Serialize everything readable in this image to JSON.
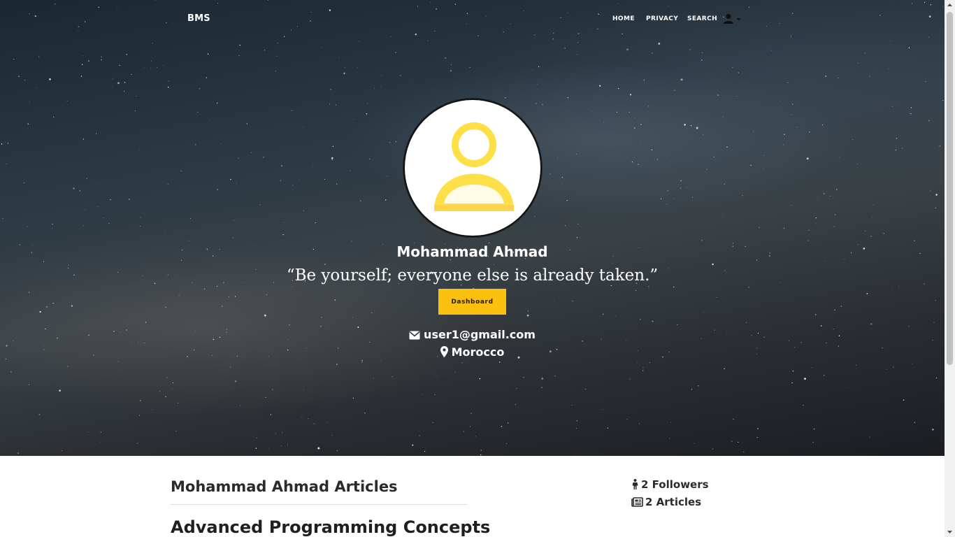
{
  "nav": {
    "brand": "BMS",
    "links": [
      "HOME",
      "PRIVACY",
      "SEARCH"
    ],
    "user_icon": "user-icon",
    "dropdown_icon": "caret-down-icon"
  },
  "profile": {
    "name": "Mohammad Ahmad",
    "quote": "“Be yourself; everyone else is already taken.”",
    "dashboard_label": "Dashboard",
    "email": "user1@gmail.com",
    "location": "Morocco",
    "email_icon": "envelope-icon",
    "location_icon": "map-marker-icon",
    "avatar_icon": "user-avatar-icon"
  },
  "articles": {
    "heading": "Mohammad Ahmad Articles",
    "items": [
      "Advanced Programming Concepts"
    ]
  },
  "stats": {
    "followers": "2 Followers",
    "articles": "2 Articles",
    "followers_icon": "person-icon",
    "articles_icon": "newspaper-icon"
  },
  "colors": {
    "accent": "#fcc10f",
    "avatar_icon": "#fde047",
    "text_dark": "#2b2b2b"
  }
}
